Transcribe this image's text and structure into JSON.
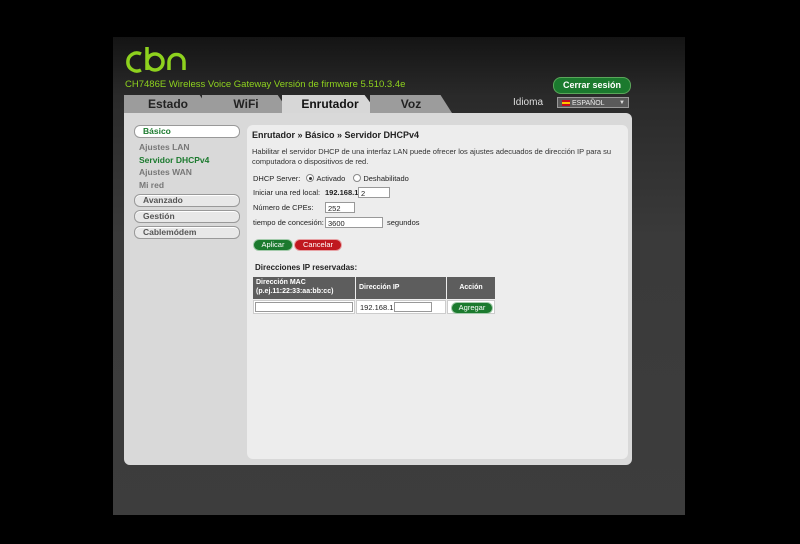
{
  "header": {
    "logo_text": "cbn",
    "subtitle": "CH7486E Wireless Voice Gateway   Versión de firmware 5.510.3.4e",
    "logout_label": "Cerrar sesión"
  },
  "tabs": [
    {
      "label": "Estado"
    },
    {
      "label": "WiFi"
    },
    {
      "label": "Enrutador"
    },
    {
      "label": "Voz"
    }
  ],
  "language": {
    "label": "Idioma",
    "selected": "ESPAÑOL"
  },
  "sidebar": {
    "basico": "Básico",
    "sub": [
      "Ajustes LAN",
      "Servidor DHCPv4",
      "Ajustes WAN",
      "Mi red"
    ],
    "avanzado": "Avanzado",
    "gestion": "Gestión",
    "cablemodem": "Cablemódem"
  },
  "content": {
    "title": "Enrutador » Básico » Servidor DHCPv4",
    "description": "Habilitar el servidor DHCP de una interfaz LAN puede ofrecer los ajustes adecuados de dirección IP para su computadora o dispositivos de red.",
    "dhcp_label": "DHCP Server:",
    "dhcp_on": "Activado",
    "dhcp_off": "Deshabilitado",
    "start_label": "Iniciar una red local:",
    "start_prefix": "192.168.1.",
    "start_value": "2",
    "cpes_label": "Número de CPEs:",
    "cpes_value": "252",
    "lease_label": "tiempo de concesión:",
    "lease_value": "3600",
    "lease_unit": "segundos",
    "apply": "Aplicar",
    "cancel": "Cancelar",
    "reserved_title": "Direcciones IP reservadas:",
    "col_mac_1": "Dirección MAC",
    "col_mac_2": "(p.ej.11:22:33:aa:bb:cc)",
    "col_ip": "Dirección IP",
    "col_action": "Acción",
    "ip_prefix": "192.168.1.",
    "add": "Agregar"
  }
}
